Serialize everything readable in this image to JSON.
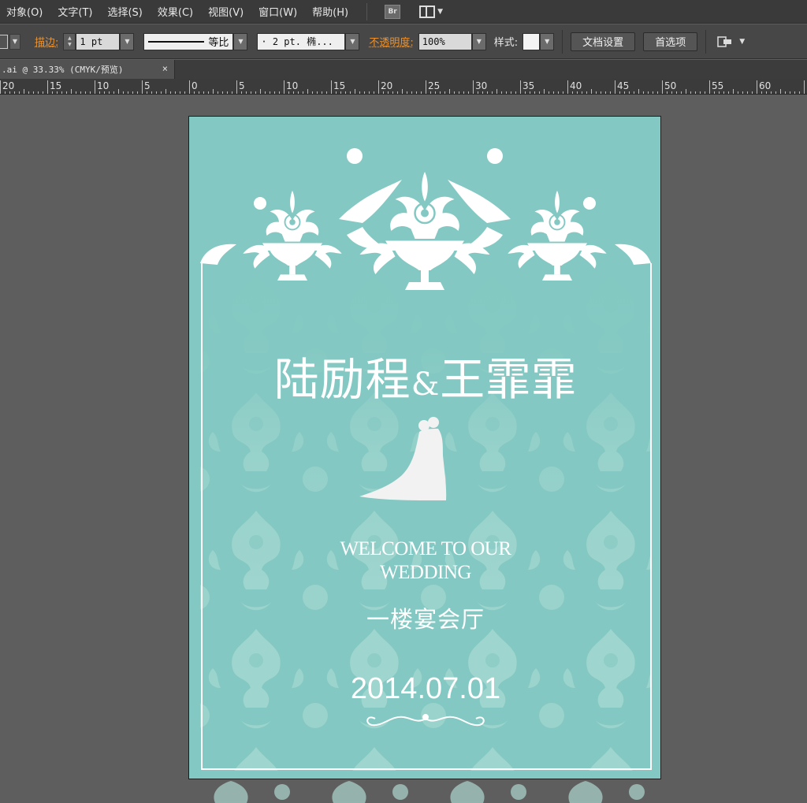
{
  "menubar": {
    "items": [
      "对象(O)",
      "文字(T)",
      "选择(S)",
      "效果(C)",
      "视图(V)",
      "窗口(W)",
      "帮助(H)"
    ],
    "bridge_label": "Br"
  },
  "controlbar": {
    "stroke_label": "描边:",
    "stroke_weight": "1 pt",
    "profile_label": "等比",
    "brush_value": "· 2 pt. 椭...",
    "opacity_label": "不透明度:",
    "opacity_value": "100%",
    "style_label": "样式:",
    "doc_setup_button": "文档设置",
    "preferences_button": "首选项"
  },
  "document_tab": {
    "title": ".ai @ 33.33% (CMYK/预览)",
    "close": "×"
  },
  "ruler": {
    "labels": [
      "20",
      "15",
      "10",
      "5",
      "0",
      "5",
      "10",
      "15",
      "20",
      "25",
      "30",
      "35",
      "40",
      "45",
      "50",
      "55",
      "60"
    ]
  },
  "invitation": {
    "name_groom": "陆励程",
    "ampersand": "&",
    "name_bride": "王霏霏",
    "welcome_line1": "WELCOME TO OUR",
    "welcome_line2": "WEDDING",
    "venue": "一楼宴会厅",
    "date": "2014.07.01"
  },
  "colors": {
    "artboard_bg": "#83c8c2",
    "ornament": "#ffffff",
    "damask_pattern": "#b4e0d8",
    "ui_orange": "#f0922a"
  }
}
